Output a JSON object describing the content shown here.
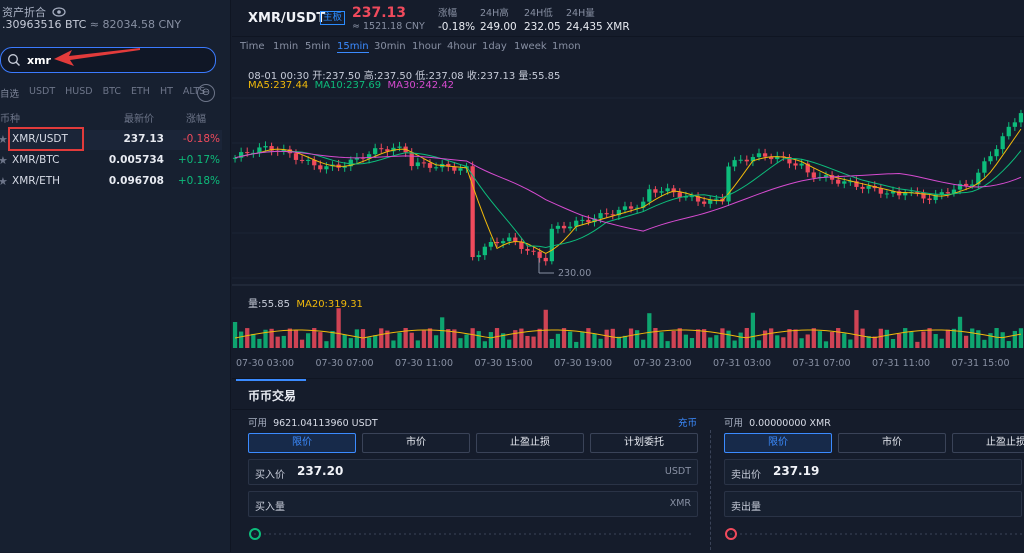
{
  "assets": {
    "title": "资产折合",
    "btc_value": ".30963516 BTC",
    "cny_value": "≈ 82034.58 CNY"
  },
  "search": {
    "value": "xmr",
    "placeholder": ""
  },
  "market_tabs": [
    "自选",
    "USDT",
    "HUSD",
    "BTC",
    "ETH",
    "HT",
    "ALTS"
  ],
  "list_header": {
    "pair": "币种",
    "price": "最新价",
    "change": "涨幅"
  },
  "pairs": [
    {
      "pair": "XMR/USDT",
      "price": "237.13",
      "change": "-0.18%",
      "dir": "down"
    },
    {
      "pair": "XMR/BTC",
      "price": "0.005734",
      "change": "+0.17%",
      "dir": "up"
    },
    {
      "pair": "XMR/ETH",
      "price": "0.096708",
      "change": "+0.18%",
      "dir": "up"
    }
  ],
  "header": {
    "pair": "XMR/USDT",
    "badge": "主板",
    "price": "237.13",
    "cny": "≈ 1521.18 CNY",
    "stats": [
      {
        "label": "涨幅",
        "value": "-0.18%"
      },
      {
        "label": "24H高",
        "value": "249.00"
      },
      {
        "label": "24H低",
        "value": "232.05"
      },
      {
        "label": "24H量",
        "value": "24,435 XMR"
      }
    ]
  },
  "timeframes": [
    "Time",
    "1min",
    "5min",
    "15min",
    "30min",
    "1hour",
    "4hour",
    "1day",
    "1week",
    "1mon"
  ],
  "active_timeframe": "15min",
  "chart_info": {
    "ohlc": "08-01 00:30  开:237.50  高:237.50  低:237.08  收:237.13  量:55.85",
    "ma5": "MA5:237.44",
    "ma10": "MA10:237.69",
    "ma30": "MA30:242.42",
    "vol": "量:55.85",
    "ma20": "MA20:319.31",
    "min_label": "230.00"
  },
  "x_axis": [
    "07-30 03:00",
    "07-30 07:00",
    "07-30 11:00",
    "07-30 15:00",
    "07-30 19:00",
    "07-30 23:00",
    "07-31 03:00",
    "07-31 07:00",
    "07-31 11:00",
    "07-31 15:00"
  ],
  "trade": {
    "tab": "币币交易",
    "buy_avail_label": "可用",
    "buy_avail": "9621.04113960 USDT",
    "charge": "充币",
    "sell_avail_label": "可用",
    "sell_avail": "0.00000000 XMR",
    "order_types": [
      "限价",
      "市价",
      "止盈止损",
      "计划委托"
    ],
    "buy_price_label": "买入价",
    "buy_price": "237.20",
    "buy_price_unit": "USDT",
    "buy_amount_label": "买入量",
    "buy_amount_unit": "XMR",
    "sell_price_label": "卖出价",
    "sell_price": "237.19",
    "sell_amount_label": "卖出量"
  },
  "colors": {
    "up": "#0dbc7b",
    "down": "#f04a5c",
    "accent": "#3b8bff",
    "ma5": "#f0b90b",
    "ma10": "#0dbc7b",
    "ma30": "#d64bd0"
  }
}
